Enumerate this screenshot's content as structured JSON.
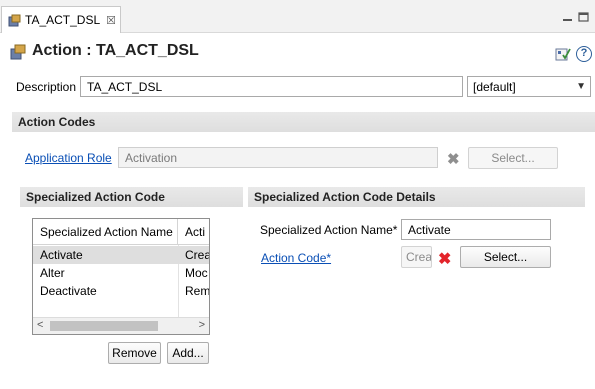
{
  "tab": {
    "label": "TA_ACT_DSL",
    "close": "☒"
  },
  "header": {
    "title": "Action : TA_ACT_DSL",
    "help": "?"
  },
  "description": {
    "label": "Description",
    "value": "TA_ACT_DSL",
    "locale": "[default]"
  },
  "action_codes": {
    "heading": "Action Codes",
    "application_role_link": "Application Role",
    "application_role_value": "Activation",
    "clear_glyph": "✖",
    "select_label": "Select..."
  },
  "specialized": {
    "heading": "Specialized Action Code",
    "columns": [
      "Specialized Action Name",
      "Acti"
    ],
    "rows": [
      {
        "name": "Activate",
        "code": "Crea"
      },
      {
        "name": "Alter",
        "code": "Moc"
      },
      {
        "name": "Deactivate",
        "code": "Rem"
      }
    ],
    "scroll_left": "<",
    "scroll_right": ">",
    "remove_label": "Remove",
    "add_label": "Add..."
  },
  "details": {
    "heading": "Specialized Action Code Details",
    "name_label": "Specialized Action Name*",
    "name_value": "Activate",
    "code_link": "Action Code*",
    "code_button_text": "Crea",
    "remove_glyph": "✖",
    "select_label": "Select..."
  },
  "colors": {
    "link": "#0a4fb5",
    "remove_red": "#e3242b",
    "section_bg": "#e2e2e2"
  }
}
